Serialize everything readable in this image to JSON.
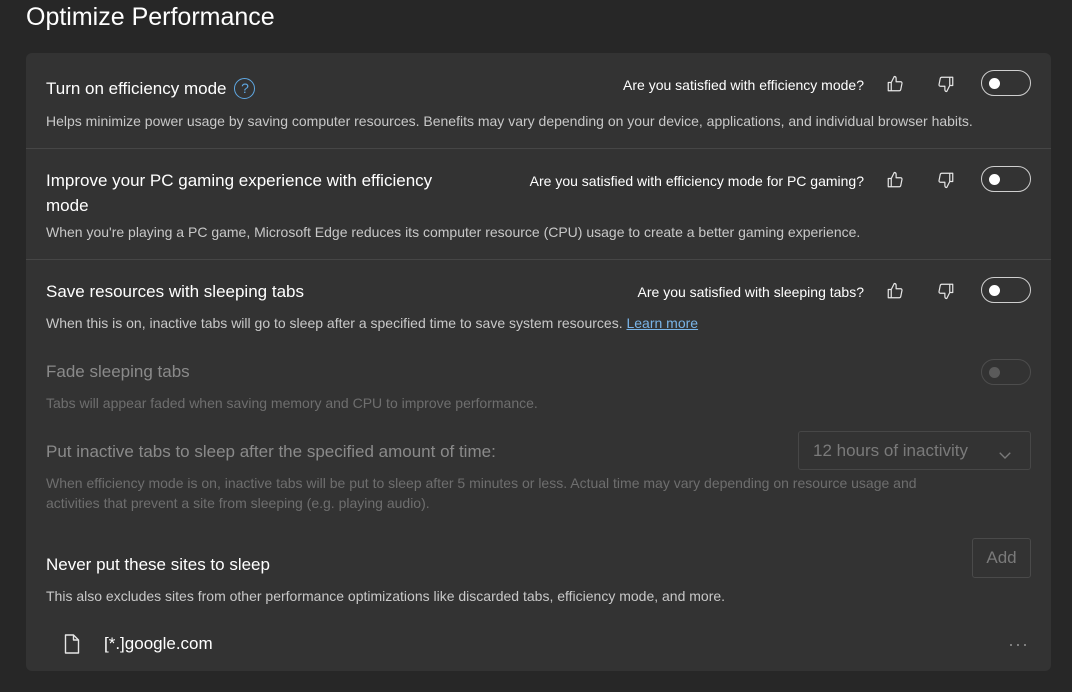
{
  "page": {
    "title": "Optimize Performance"
  },
  "efficiency_mode": {
    "title": "Turn on efficiency mode",
    "help_icon": "?",
    "description": "Helps minimize power usage by saving computer resources. Benefits may vary depending on your device, applications, and individual browser habits.",
    "question": "Are you satisfied with efficiency mode?",
    "enabled": false
  },
  "gaming": {
    "title_line1": "Improve your PC gaming experience with efficiency",
    "title_line2": "mode",
    "description": "When you're playing a PC game, Microsoft Edge reduces its computer resource (CPU) usage to create a better gaming experience.",
    "question": "Are you satisfied with efficiency mode for PC gaming?",
    "enabled": false
  },
  "sleeping_tabs": {
    "title": "Save resources with sleeping tabs",
    "description": "When this is on, inactive tabs will go to sleep after a specified time to save system resources.",
    "link": "Learn more",
    "question": "Are you satisfied with sleeping tabs?",
    "enabled": false
  },
  "fade_tabs": {
    "title": "Fade sleeping tabs",
    "description": "Tabs will appear faded when saving memory and CPU to improve performance.",
    "enabled": false
  },
  "sleep_after": {
    "title": "Put inactive tabs to sleep after the specified amount of time:",
    "description_line1": "When efficiency mode is on, inactive tabs will be put to sleep after 5 minutes or less. Actual time may vary depending on resource usage and",
    "description_line2": "activities that prevent a site from sleeping (e.g. playing audio).",
    "selected": "12 hours of inactivity"
  },
  "never_sleep": {
    "title": "Never put these sites to sleep",
    "add_label": "Add",
    "description": "This also excludes sites from other performance optimizations like discarded tabs, efficiency mode, and more.",
    "sites": [
      "[*.]google.com"
    ],
    "more_icon": "···"
  },
  "icons": {
    "thumbs_up": "thumbs-up-icon",
    "thumbs_down": "thumbs-down-icon",
    "file": "file-icon",
    "chevron": "chevron-down-icon"
  },
  "colors": {
    "background": "#272727",
    "card": "#333333",
    "accent": "#5fa8e3"
  }
}
